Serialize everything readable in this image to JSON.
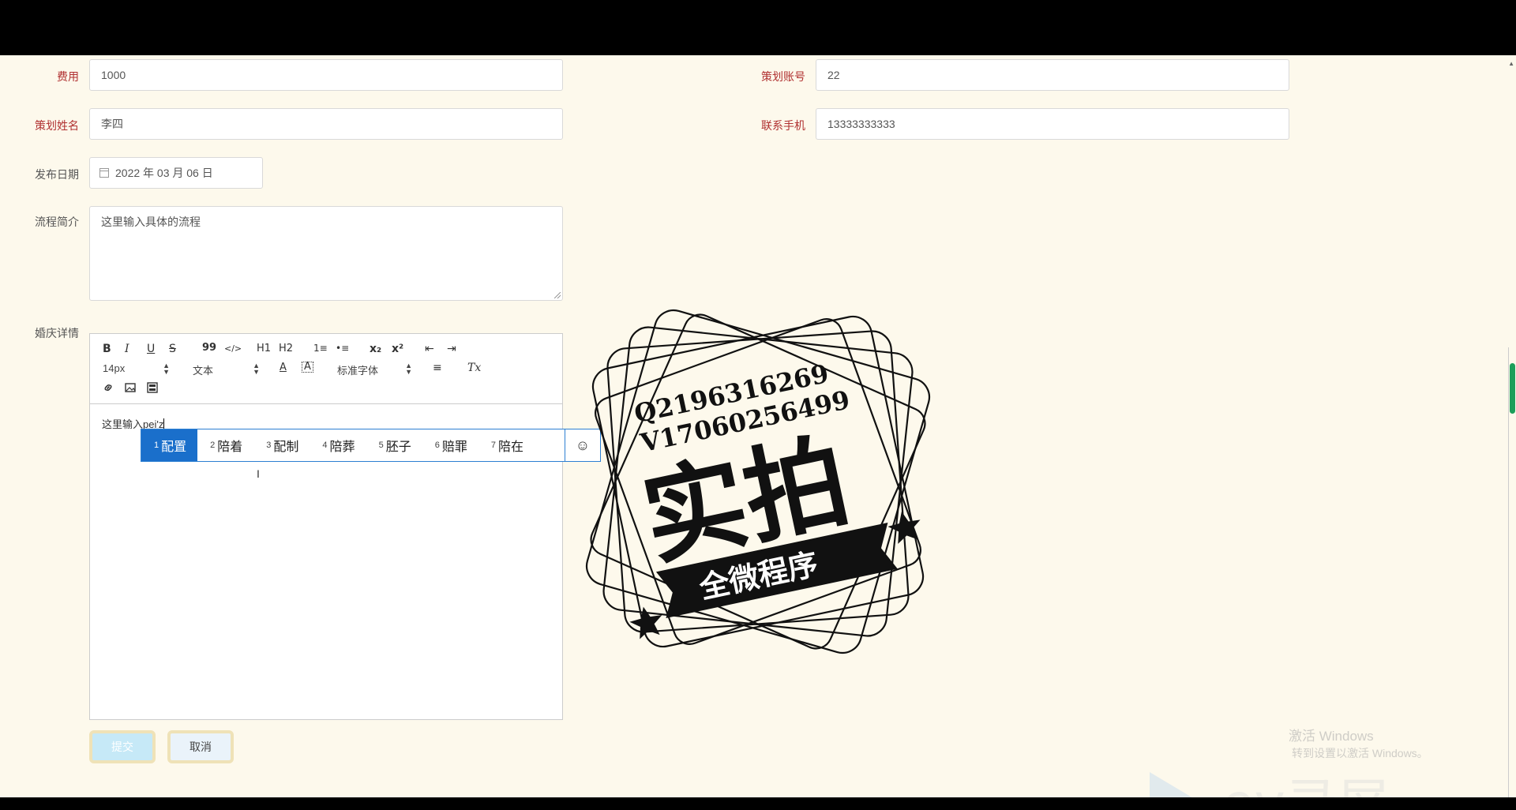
{
  "form": {
    "fee": {
      "label": "费用",
      "value": "1000"
    },
    "planner_account": {
      "label": "策划账号",
      "value": "22"
    },
    "planner_name": {
      "label": "策划姓名",
      "value": "李四"
    },
    "contact_phone": {
      "label": "联系手机",
      "value": "13333333333"
    },
    "publish_date": {
      "label": "发布日期",
      "value": "2022 年 03 月 06 日"
    },
    "process_intro": {
      "label": "流程简介",
      "value": "这里输入具体的流程"
    },
    "wedding_details": {
      "label": "婚庆详情"
    }
  },
  "editor": {
    "toolbar": {
      "row1": [
        "B",
        "I",
        "U",
        "S",
        "99",
        "</>",
        "H1",
        "H2",
        "1≡",
        "•≡",
        "x₂",
        "x²",
        "⇤",
        "⇥"
      ],
      "font_size": "14px",
      "block_type": "文本",
      "font_family": "标准字体",
      "text_color": "A",
      "bg_color": "A",
      "align": "≡",
      "clear": "Tx"
    },
    "content_prefix": "这里输入",
    "composition": "pei'z"
  },
  "ime": {
    "candidates": [
      {
        "num": "1",
        "text": "配置"
      },
      {
        "num": "2",
        "text": "陪着"
      },
      {
        "num": "3",
        "text": "配制"
      },
      {
        "num": "4",
        "text": "陪葬"
      },
      {
        "num": "5",
        "text": "胚子"
      },
      {
        "num": "6",
        "text": "赔罪"
      },
      {
        "num": "7",
        "text": "陪在"
      }
    ],
    "emoji": "☺"
  },
  "buttons": {
    "submit": "提交",
    "cancel": "取消"
  },
  "stamp": {
    "line1": "Q2196316269",
    "line2": "V17060256499",
    "main": "实拍",
    "banner": "全微程序"
  },
  "watermark": {
    "activate_title": "激活 Windows",
    "activate_sub": "转到设置以激活 Windows。",
    "brand": "ev录屏"
  },
  "colors": {
    "page_bg": "#fdf9ec",
    "required_label": "#b03030",
    "ime_selected": "#1a6fcb",
    "scroll_thumb": "#1d9e5a"
  }
}
